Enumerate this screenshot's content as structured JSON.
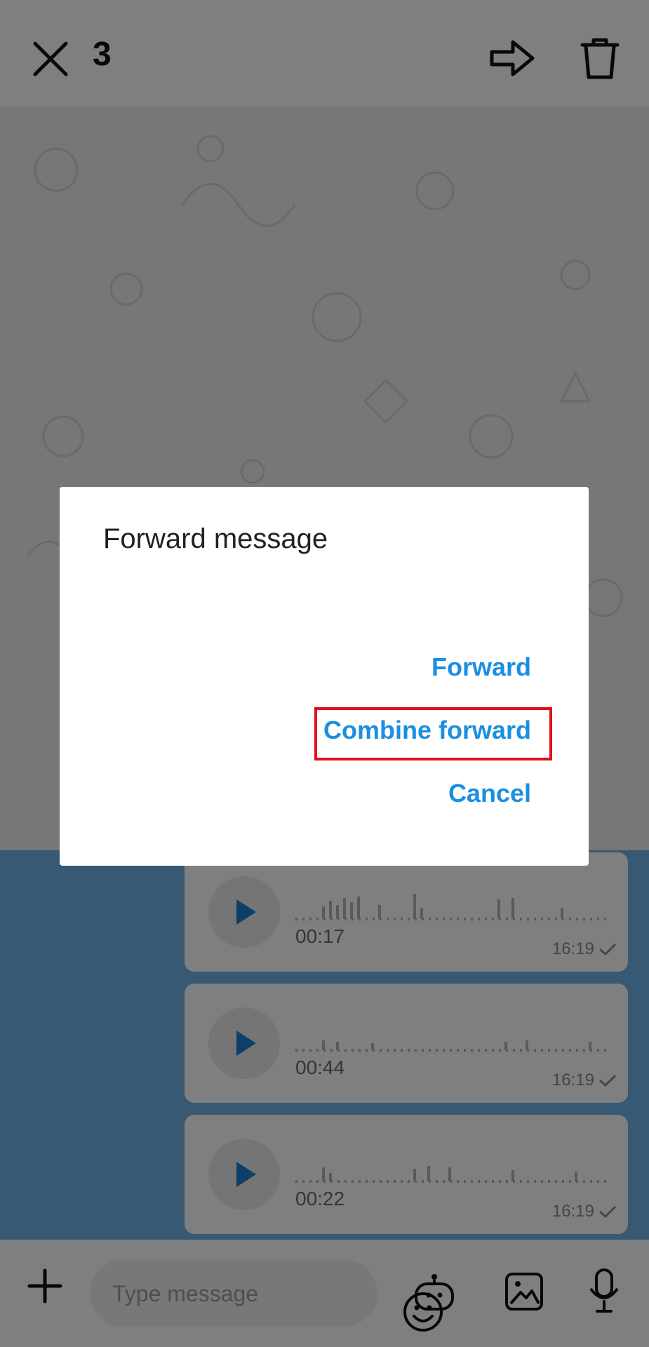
{
  "topbar": {
    "selected_count": "3"
  },
  "messages": [
    {
      "duration": "00:17",
      "time": "16:19"
    },
    {
      "duration": "00:44",
      "time": "16:19"
    },
    {
      "duration": "00:22",
      "time": "16:19"
    }
  ],
  "dialog": {
    "title": "Forward message",
    "actions": {
      "forward": "Forward",
      "combine_forward": "Combine forward",
      "cancel": "Cancel"
    }
  },
  "composer": {
    "placeholder": "Type message"
  },
  "colors": {
    "accent": "#1a8fe0",
    "highlight": "#e0101a",
    "selected_bg": "#6fb3e6"
  }
}
